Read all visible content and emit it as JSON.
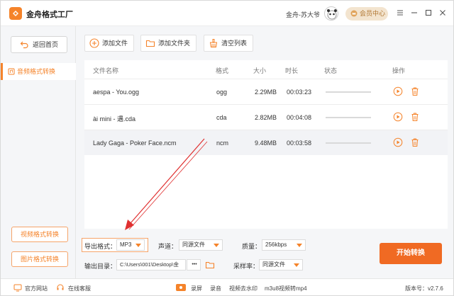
{
  "app": {
    "title": "金舟格式工厂",
    "user_name": "金舟-苏大爷",
    "vip_label": "会员中心"
  },
  "sidebar": {
    "back_label": "返回首页",
    "active_item": "音频格式转换",
    "video_btn": "视频格式转换",
    "image_btn": "图片格式转换"
  },
  "toolbar": {
    "add_file": "添加文件",
    "add_folder": "添加文件夹",
    "clear_list": "清空列表"
  },
  "list": {
    "columns": {
      "name": "文件名称",
      "format": "格式",
      "size": "大小",
      "duration": "时长",
      "status": "状态",
      "actions": "操作"
    },
    "rows": [
      {
        "name": "aespa - You.ogg",
        "format": "ogg",
        "size": "2.29MB",
        "duration": "00:03:23"
      },
      {
        "name": "ài mini - 遇.cda",
        "format": "cda",
        "size": "2.82MB",
        "duration": "00:04:08"
      },
      {
        "name": "Lady Gaga - Poker Face.ncm",
        "format": "ncm",
        "size": "9.48MB",
        "duration": "00:03:58"
      }
    ]
  },
  "settings": {
    "format_label": "导出格式：",
    "format_value": "MP3",
    "channel_label": "声道：",
    "channel_value": "同源文件",
    "quality_label": "质量：",
    "quality_value": "256kbps",
    "output_label": "输出目录：",
    "output_value": "C:\\Users\\001\\Desktop\\金",
    "browse_label": "•••",
    "sample_label": "采样率：",
    "sample_value": "同源文件",
    "start_label": "开始转换"
  },
  "statusbar": {
    "website": "官方网站",
    "support": "在线客服",
    "record": "录屏",
    "audio": "录音",
    "watermark": "视频去水印",
    "m3u8": "m3u8视频转mp4",
    "version": "版本号：v2.7.6"
  },
  "colors": {
    "accent": "#f5832a",
    "start_button": "#f06a23",
    "annotation_arrow": "#e03030"
  }
}
